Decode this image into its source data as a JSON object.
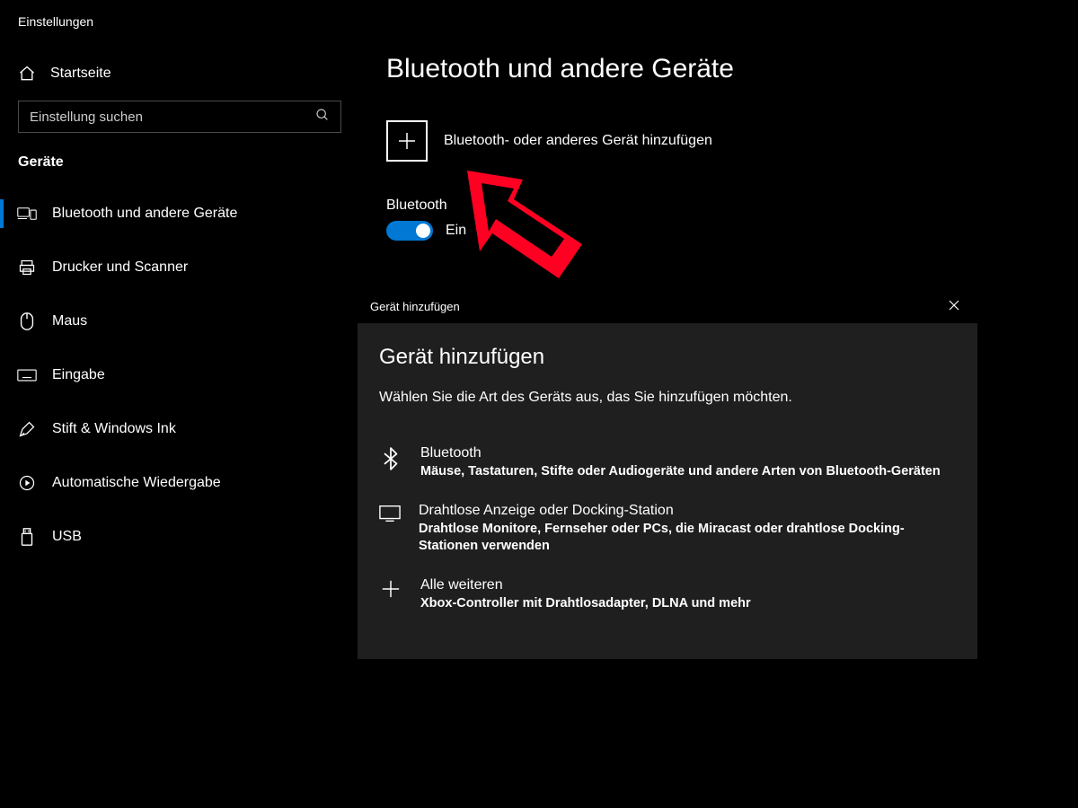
{
  "window_title": "Einstellungen",
  "home_label": "Startseite",
  "search": {
    "placeholder": "Einstellung suchen"
  },
  "section_header": "Geräte",
  "nav_items": [
    {
      "label": "Bluetooth und andere Geräte"
    },
    {
      "label": "Drucker und Scanner"
    },
    {
      "label": "Maus"
    },
    {
      "label": "Eingabe"
    },
    {
      "label": "Stift & Windows Ink"
    },
    {
      "label": "Automatische Wiedergabe"
    },
    {
      "label": "USB"
    }
  ],
  "page_title": "Bluetooth und andere Geräte",
  "add_device_label": "Bluetooth- oder anderes Gerät hinzufügen",
  "bluetooth": {
    "label": "Bluetooth",
    "state": "Ein"
  },
  "dialog": {
    "titlebar": "Gerät hinzufügen",
    "heading": "Gerät hinzufügen",
    "subtext": "Wählen Sie die Art des Geräts aus, das Sie hinzufügen möchten.",
    "options": [
      {
        "title": "Bluetooth",
        "desc": "Mäuse, Tastaturen, Stifte oder Audiogeräte und andere Arten von Bluetooth-Geräten"
      },
      {
        "title": "Drahtlose Anzeige oder Docking-Station",
        "desc": "Drahtlose Monitore, Fernseher oder PCs, die Miracast oder drahtlose Docking-Stationen verwenden"
      },
      {
        "title": "Alle weiteren",
        "desc": "Xbox-Controller mit Drahtlosadapter, DLNA und mehr"
      }
    ]
  },
  "colors": {
    "accent": "#0078d4",
    "annotation": "#ff0022"
  }
}
